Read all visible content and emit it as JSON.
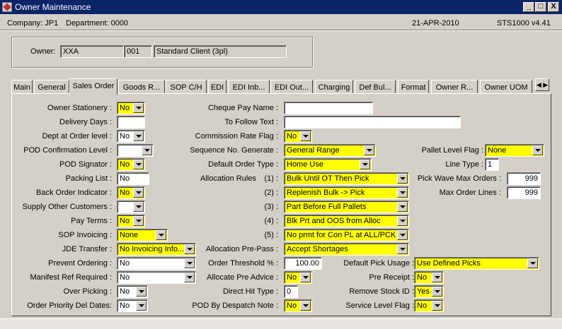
{
  "window": {
    "title": "Owner Maintenance",
    "minimize_label": "_",
    "maximize_label": "□",
    "close_label": "X"
  },
  "status": {
    "company": "Company:  JP1",
    "department": "Department:  0000",
    "date": "21-APR-2010",
    "version": "STS1000  v4.41"
  },
  "owner": {
    "label": "Owner:",
    "code": "XXA",
    "number": "001",
    "name": "Standard Client (3pl)"
  },
  "tabs": [
    {
      "label": "Main"
    },
    {
      "label": "General"
    },
    {
      "label": "Sales Order"
    },
    {
      "label": "Goods R..."
    },
    {
      "label": "SOP C/H"
    },
    {
      "label": "EDI"
    },
    {
      "label": "EDI Inb..."
    },
    {
      "label": "EDI Out..."
    },
    {
      "label": "Charging"
    },
    {
      "label": "Def Bul..."
    },
    {
      "label": "Format"
    },
    {
      "label": "Owner R..."
    },
    {
      "label": "Owner UOM"
    }
  ],
  "tab_scroll_label": "◀ ▶",
  "active_tab": "Sales Order",
  "left": {
    "owner_stationery": {
      "label": "Owner Stationery :",
      "value": "No"
    },
    "delivery_days": {
      "label": "Delivery Days :",
      "value": ""
    },
    "dept_at_order_level": {
      "label": "Dept at Order level :",
      "value": "No"
    },
    "pod_confirmation_level": {
      "label": "POD Confirmation Level :",
      "value": ""
    },
    "pod_signator": {
      "label": "POD Signator :",
      "value": "No"
    },
    "packing_list": {
      "label": "Packing List :",
      "value": "No"
    },
    "back_order_indicator": {
      "label": "Back Order Indicator :",
      "value": "No"
    },
    "supply_other_customers": {
      "label": "Supply Other Customers :",
      "value": ""
    },
    "pay_terms": {
      "label": "Pay Terms :",
      "value": "No"
    },
    "sop_invoicing": {
      "label": "SOP Invoicing :",
      "value": "None"
    },
    "jde_transfer": {
      "label": "JDE Transfer :",
      "value": "No Invoicing Info..."
    },
    "prevent_ordering": {
      "label": "Prevent Ordering :",
      "value": "No"
    },
    "manifest_ref_required": {
      "label": "Manifest Ref Required :",
      "value": "No"
    },
    "over_picking": {
      "label": "Over Picking :",
      "value": "No"
    },
    "order_priority_del_dates": {
      "label": "Order Priority Del Dates:",
      "value": "No"
    }
  },
  "middle": {
    "cheque_pay_name": {
      "label": "Cheque Pay Name :",
      "value": ""
    },
    "to_follow_text": {
      "label": "To Follow Text :",
      "value": ""
    },
    "commission_rate_flag": {
      "label": "Commission Rate Flag :",
      "value": "No"
    },
    "sequence_no_generate": {
      "label": "Sequence No. Generate :",
      "value": "General Range"
    },
    "default_order_type": {
      "label": "Default Order Type :",
      "value": "Home Use"
    },
    "allocation_rules_label": "Allocation Rules",
    "allocation_rules": [
      {
        "num": "(1) :",
        "value": "Bulk Until OT Then Pick"
      },
      {
        "num": "(2) :",
        "value": "Replenish Bulk -> Pick"
      },
      {
        "num": "(3) :",
        "value": "Part Before Full Pallets"
      },
      {
        "num": "(4) :",
        "value": "Blk Prt and OOS from Alloc"
      },
      {
        "num": "(5) :",
        "value": "No prmt for Con PL at ALL/PCK"
      }
    ],
    "allocation_pre_pass": {
      "label": "Allocation Pre-Pass :",
      "value": "Accept Shortages"
    },
    "order_threshold": {
      "label": "Order Threshold % :",
      "value": "100.00"
    },
    "allocate_pre_advice": {
      "label": "Allocate  Pre Advice :",
      "value": "No"
    },
    "direct_hit_type": {
      "label": "Direct Hit Type :",
      "value": "0"
    },
    "pod_by_despatch_note": {
      "label": "POD By Despatch Note :",
      "value": "No"
    }
  },
  "right": {
    "pallet_level_flag": {
      "label": "Pallet Level Flag :",
      "value": "None"
    },
    "line_type": {
      "label": "Line Type :",
      "value": "1"
    },
    "pick_wave_max_orders": {
      "label": "Pick Wave Max Orders :",
      "value": "999"
    },
    "max_order_lines": {
      "label": "Max Order Lines :",
      "value": "999"
    },
    "default_pick_usage": {
      "label": "Default Pick Usage :",
      "value": "Use Defined Picks"
    },
    "pre_receipt": {
      "label": "Pre Receipt :",
      "value": "No"
    },
    "remove_stock_id": {
      "label": "Remove Stock ID :",
      "value": "Yes"
    },
    "service_level_flag": {
      "label": "Service Level Flag :",
      "value": "No"
    }
  },
  "colors": {
    "titlebar": "#0a246a",
    "highlight": "#ffff00",
    "face": "#d4d0c8"
  }
}
